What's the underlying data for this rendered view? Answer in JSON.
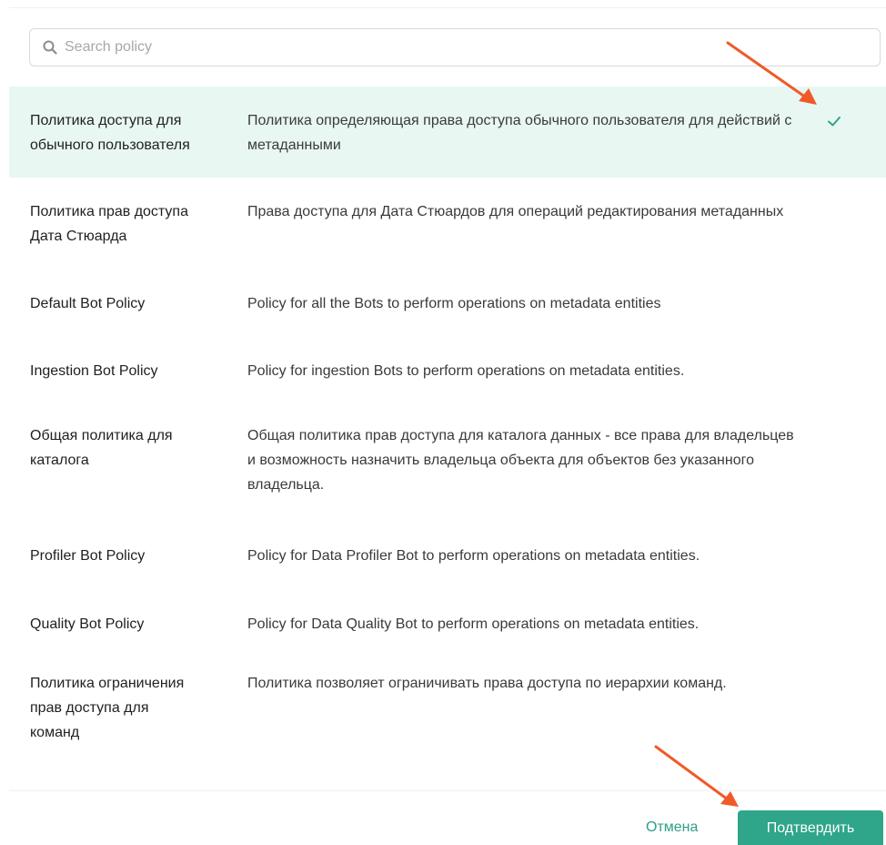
{
  "search": {
    "placeholder": "Search policy"
  },
  "policies": [
    {
      "name": "Политика доступа для\nобычного пользователя",
      "description": "Политика определяющая права доступа обычного пользователя для действий с метаданными",
      "selected": true
    },
    {
      "name": "Политика прав доступа\nДата Стюарда",
      "description": "Права доступа для Дата Стюардов для операций редактирования метаданных",
      "selected": false
    },
    {
      "name": "Default Bot Policy",
      "description": "Policy for all the Bots to perform operations on metadata entities",
      "selected": false
    },
    {
      "name": "Ingestion Bot Policy",
      "description": "Policy for ingestion Bots to perform operations on metadata entities.",
      "selected": false
    },
    {
      "name": "Общая политика для\nкаталога",
      "description": "Общая политика прав доступа для каталога данных - все права для владельцев и возможность назначить владельца объекта для объектов без указанного владельца.",
      "selected": false
    },
    {
      "name": "Profiler Bot Policy",
      "description": "Policy for Data Profiler Bot to perform operations on metadata entities.",
      "selected": false
    },
    {
      "name": "Quality Bot Policy",
      "description": "Policy for Data Quality Bot to perform operations on metadata entities.",
      "selected": false
    },
    {
      "name": "Политика ограничения\nправ доступа для\nкоманд",
      "description": "Политика позволяет ограничивать права доступа по иерархии команд.",
      "selected": false
    }
  ],
  "footer": {
    "cancel_label": "Отмена",
    "confirm_label": "Подтвердить"
  },
  "colors": {
    "accent": "#2fa58a",
    "selected_row_bg": "#e9f7f3",
    "annotation_arrow": "#f05a28"
  },
  "icons": {
    "search": "search-icon",
    "check": "check-icon"
  }
}
